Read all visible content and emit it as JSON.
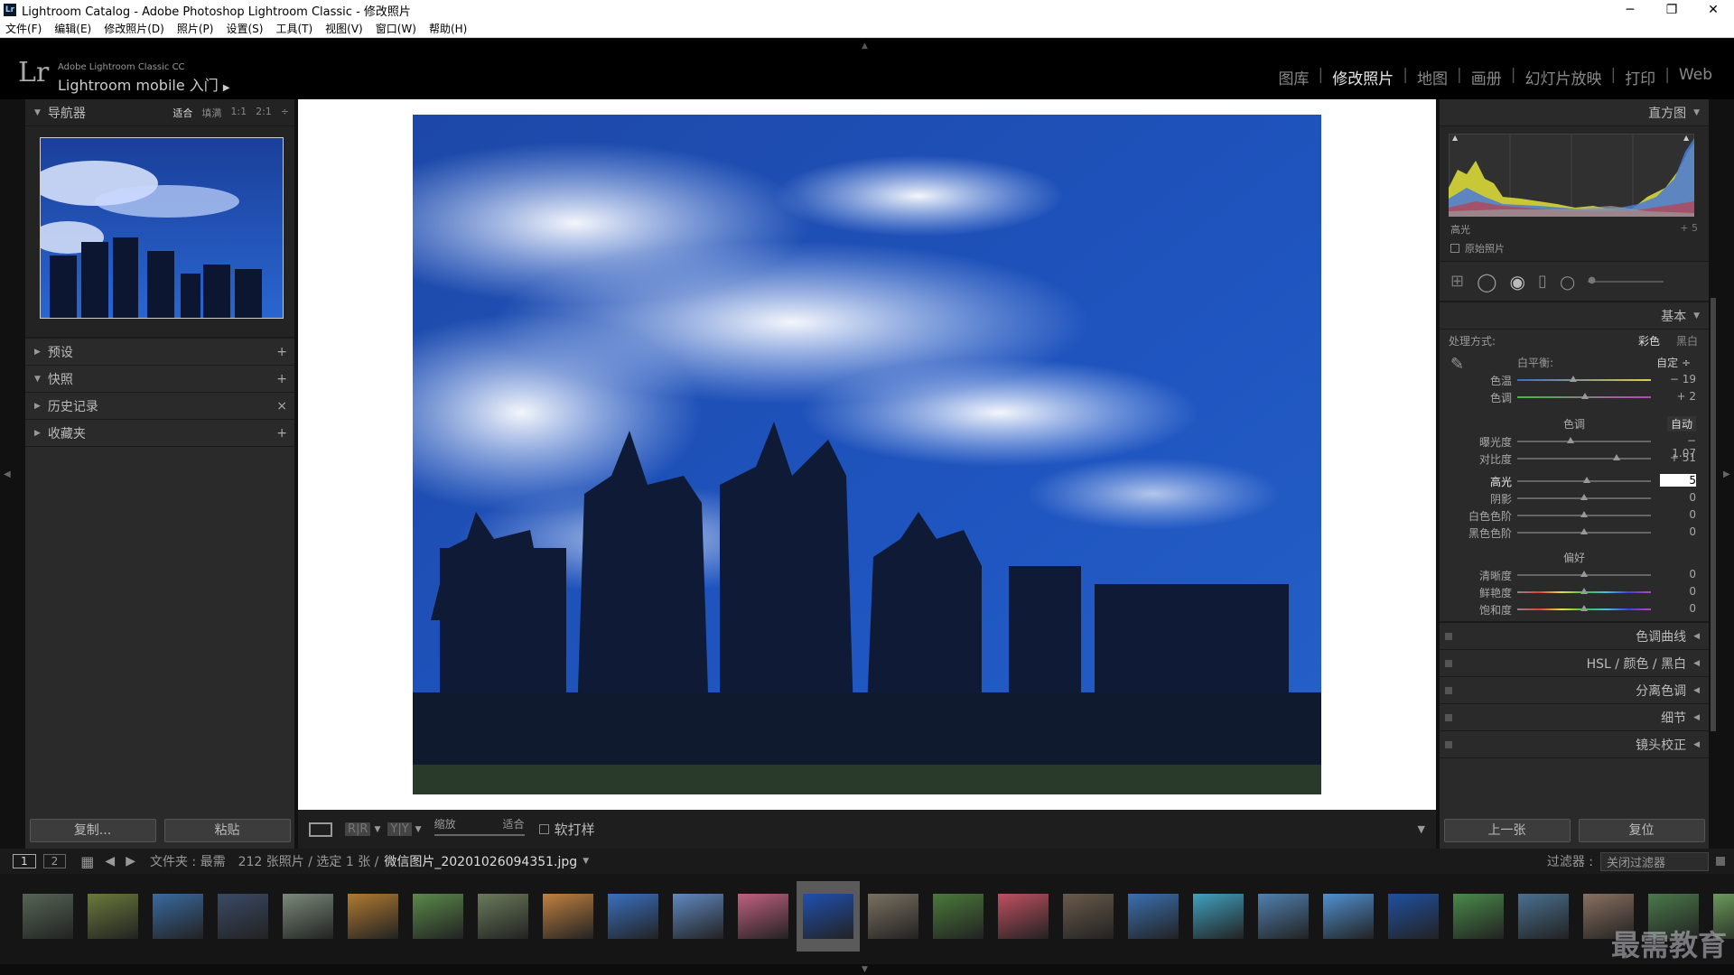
{
  "window": {
    "title": "Lightroom Catalog - Adobe Photoshop Lightroom Classic - 修改照片",
    "app_icon": "Lr"
  },
  "menu": [
    "文件(F)",
    "编辑(E)",
    "修改照片(D)",
    "照片(P)",
    "设置(S)",
    "工具(T)",
    "视图(V)",
    "窗口(W)",
    "帮助(H)"
  ],
  "header": {
    "logo": "Lr",
    "product": "Adobe Lightroom Classic CC",
    "mobile": "Lightroom mobile 入门",
    "modules": [
      "图库",
      "修改照片",
      "地图",
      "画册",
      "幻灯片放映",
      "打印",
      "Web"
    ],
    "active_module": "修改照片"
  },
  "left": {
    "navigator": {
      "title": "导航器",
      "options": [
        "适合",
        "填满",
        "1:1",
        "2:1"
      ],
      "active": "适合"
    },
    "panels": [
      {
        "label": "预设",
        "icon": "+"
      },
      {
        "label": "快照",
        "icon": "+"
      },
      {
        "label": "历史记录",
        "icon": "×"
      },
      {
        "label": "收藏夹",
        "icon": "+"
      }
    ],
    "copy_label": "复制...",
    "paste_label": "粘贴"
  },
  "toolbar": {
    "zoom_label": "缩放",
    "zoom_value": "适合",
    "softproof_label": "软打样"
  },
  "right": {
    "histogram": {
      "title": "直方图",
      "readout_label": "高光",
      "readout_value": "+ 5",
      "original_label": "原始照片"
    },
    "basic": {
      "title": "基本",
      "treatment_label": "处理方式:",
      "treatment_color": "彩色",
      "treatment_bw": "黑白",
      "wb_label": "白平衡:",
      "wb_value": "自定 ÷",
      "tone_label": "色调",
      "auto_label": "自动",
      "presence_label": "偏好",
      "sliders_wb": [
        {
          "label": "色温",
          "value": "− 19",
          "pos": 0.42,
          "track": "temp"
        },
        {
          "label": "色调",
          "value": "+ 2",
          "pos": 0.51,
          "track": "tint"
        }
      ],
      "sliders_tone": [
        {
          "label": "曝光度",
          "value": "− 1.07",
          "pos": 0.4
        },
        {
          "label": "对比度",
          "value": "+ 51",
          "pos": 0.74
        }
      ],
      "sliders_tone2": [
        {
          "label": "高光",
          "value": "5",
          "pos": 0.52,
          "active": true
        },
        {
          "label": "阴影",
          "value": "0",
          "pos": 0.5
        },
        {
          "label": "白色色阶",
          "value": "0",
          "pos": 0.5
        },
        {
          "label": "黑色色阶",
          "value": "0",
          "pos": 0.5
        }
      ],
      "sliders_presence": [
        {
          "label": "清晰度",
          "value": "0",
          "pos": 0.5,
          "track": "gray"
        },
        {
          "label": "鲜艳度",
          "value": "0",
          "pos": 0.5,
          "track": "rainbow"
        },
        {
          "label": "饱和度",
          "value": "0",
          "pos": 0.5,
          "track": "rainbow"
        }
      ]
    },
    "collapsed": [
      "色调曲线",
      "HSL / 颜色 / 黑白",
      "分离色调",
      "细节",
      "镜头校正"
    ],
    "prev_label": "上一张",
    "reset_label": "复位"
  },
  "filmbar": {
    "page1": "1",
    "page2": "2",
    "path": "文件夹 : 最需",
    "count": "212 张照片 / 选定 1 张 /",
    "filename": "微信图片_20201026094351.jpg",
    "filter_label": "过滤器 :",
    "filter_value": "关闭过滤器"
  },
  "filmstrip": {
    "selected_index": 12,
    "thumbs": [
      "#556655",
      "#6a7a3a",
      "#3a6aa0",
      "#3a4a66",
      "#7a8a7a",
      "#b07a30",
      "#5a8a4a",
      "#6a7a5a",
      "#c08040",
      "#3a70c0",
      "#6088c0",
      "#c06080",
      "#1f4fb0",
      "#7a7060",
      "#4a7a3a",
      "#c05060",
      "#6a5a4a",
      "#3a70b0",
      "#40a0c0",
      "#5080b0",
      "#5090d0",
      "#2050a0",
      "#4a8a4a",
      "#4a7090",
      "#8a7060",
      "#4a7a4a",
      "#6a9a5a"
    ]
  },
  "watermark": "最需教育"
}
